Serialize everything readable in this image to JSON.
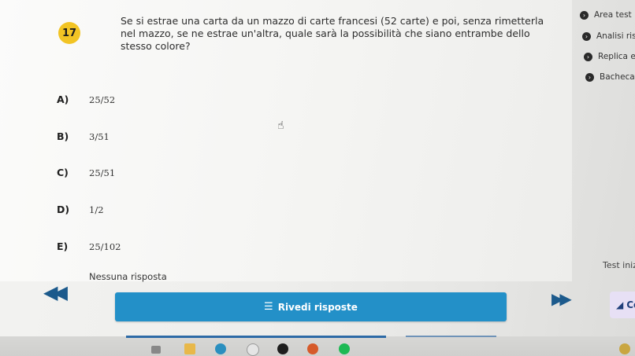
{
  "question": {
    "number": "17",
    "text": "Se si estrae una carta da un mazzo di carte francesi (52 carte) e poi, senza rimetterla nel mazzo, se ne estrae un'altra, quale sarà la possibilità che siano entrambe dello stesso colore?"
  },
  "answers": [
    {
      "label": "A)",
      "text": "25/52"
    },
    {
      "label": "B)",
      "text": "3/51"
    },
    {
      "label": "C)",
      "text": "25/51"
    },
    {
      "label": "D)",
      "text": "1/2"
    },
    {
      "label": "E)",
      "text": "25/102"
    }
  ],
  "no_answer": "Nessuna risposta",
  "sidebar": {
    "items": [
      {
        "label": "Area test"
      },
      {
        "label": "Analisi risult"
      },
      {
        "label": "Replica e ra"
      },
      {
        "label": "Bacheca q"
      }
    ],
    "test_started": "Test inizi"
  },
  "navigation": {
    "review_label": "Rivedi risposte",
    "finish_label": "Co"
  },
  "colors": {
    "accent": "#2390c8",
    "badge": "#f2c424"
  }
}
